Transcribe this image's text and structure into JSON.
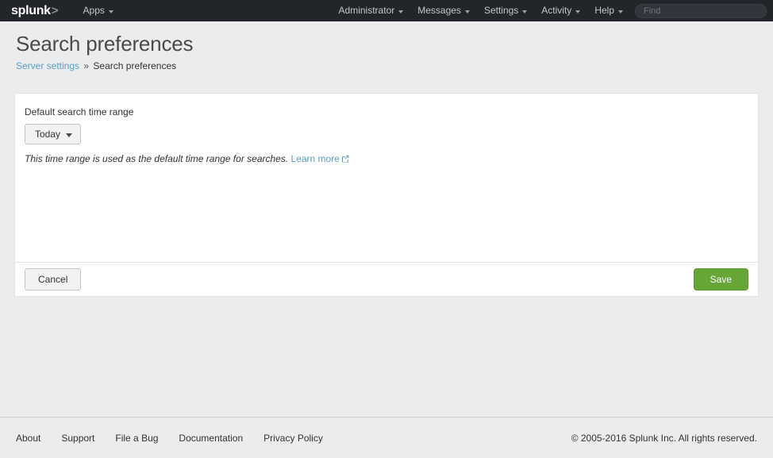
{
  "navbar": {
    "logo_text": "splunk",
    "logo_chevron": ">",
    "items": [
      {
        "label": "Apps"
      },
      {
        "label": "Administrator"
      },
      {
        "label": "Messages"
      },
      {
        "label": "Settings"
      },
      {
        "label": "Activity"
      },
      {
        "label": "Help"
      }
    ],
    "search": {
      "value": "",
      "placeholder": "Find"
    }
  },
  "header": {
    "title": "Search preferences",
    "breadcrumb": {
      "parent": "Server settings",
      "separator": "»",
      "current": "Search preferences"
    }
  },
  "form": {
    "field_label": "Default search time range",
    "time_range_value": "Today",
    "help_text": "This time range is used as the default time range for searches.",
    "learn_more_label": "Learn more"
  },
  "actions": {
    "cancel_label": "Cancel",
    "save_label": "Save"
  },
  "footer": {
    "links": [
      {
        "label": "About"
      },
      {
        "label": "Support"
      },
      {
        "label": "File a Bug"
      },
      {
        "label": "Documentation"
      },
      {
        "label": "Privacy Policy"
      }
    ],
    "copyright": "© 2005-2016 Splunk Inc. All rights reserved."
  },
  "colors": {
    "navbar_bg": "#22252a",
    "page_bg": "#ececec",
    "accent_green": "#65a637",
    "link_blue": "#5a9ec7"
  }
}
